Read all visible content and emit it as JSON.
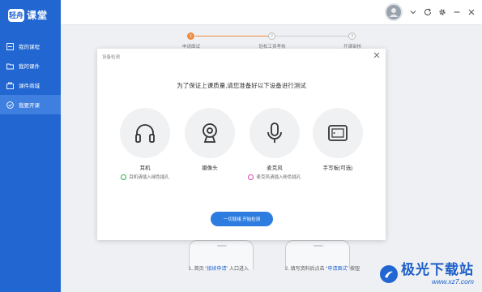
{
  "app": {
    "logo_badge": "轻舟",
    "logo_text": "课堂"
  },
  "sidebar": {
    "items": [
      {
        "label": "我的课程",
        "icon": "course-icon"
      },
      {
        "label": "我的课件",
        "icon": "folder-icon"
      },
      {
        "label": "课件商城",
        "icon": "shop-icon"
      },
      {
        "label": "我要开课",
        "icon": "check-circle-icon",
        "active": true
      }
    ]
  },
  "topbar": {
    "icons": [
      "avatar",
      "chevron-down-icon",
      "refresh-icon",
      "gear-icon",
      "minimize-icon",
      "close-icon"
    ]
  },
  "steps": {
    "items": [
      {
        "num": "1",
        "label": "申请面试",
        "done": true
      },
      {
        "num": "2",
        "label": "轻松工资考核"
      },
      {
        "num": "3",
        "label": "开课审核"
      }
    ]
  },
  "modal": {
    "title": "设备检测",
    "heading": "为了保证上课质量,请您准备好以下设备进行测试",
    "devices": [
      {
        "name": "耳机",
        "hint": "耳机请插入绿色插孔",
        "dot": "green"
      },
      {
        "name": "摄像头",
        "hint": ""
      },
      {
        "name": "麦克风",
        "hint": "麦克风请插入粉色插孔",
        "dot": "pink"
      },
      {
        "name": "手写板(可选)",
        "hint": ""
      }
    ],
    "start_button": "一切就绪 开始检测"
  },
  "hints": {
    "left_pre": "1. 首页 “",
    "left_hl": "接续申请",
    "left_post": "” 入口进入",
    "right_pre": "2. 填写资料后点击 “",
    "right_hl": "申请面试",
    "right_post": "” 按钮"
  },
  "watermark": {
    "line1": "极光下载站",
    "line2": "www.xz7.com"
  },
  "colors": {
    "sidebar": "#2166d1",
    "accent_orange": "#f08a3c",
    "button": "#2d7de0",
    "green_jack": "#2cb34a",
    "pink_jack": "#d24bb0"
  }
}
